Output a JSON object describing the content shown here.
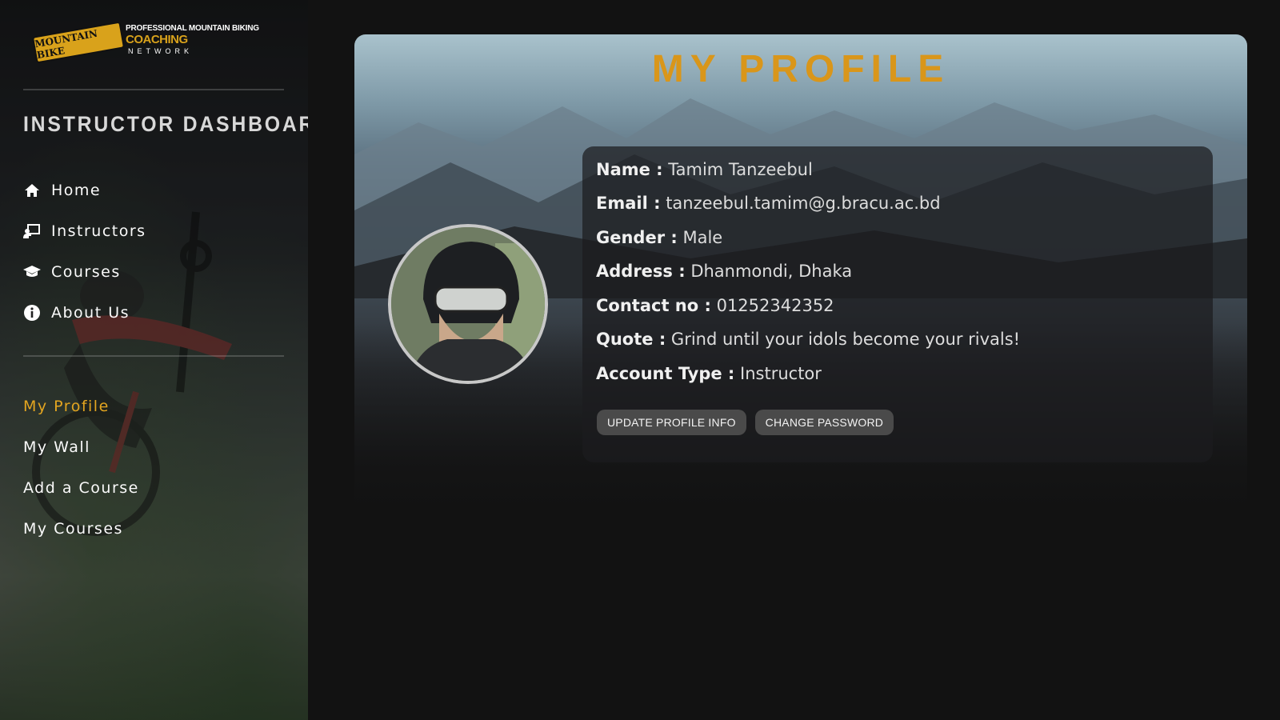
{
  "brand": {
    "badge_text": "MOUNTAIN BIKE",
    "line1": "PROFESSIONAL MOUNTAIN BIKING",
    "line2": "COACHING",
    "line3": "NETWORK"
  },
  "sidebar": {
    "title": "INSTRUCTOR DASHBOARD",
    "nav": [
      {
        "label": "Home",
        "icon": "home-icon"
      },
      {
        "label": "Instructors",
        "icon": "instructor-icon"
      },
      {
        "label": "Courses",
        "icon": "graduation-cap-icon"
      },
      {
        "label": "About Us",
        "icon": "info-icon"
      }
    ],
    "sub": [
      {
        "label": "My Profile",
        "active": true
      },
      {
        "label": "My Wall"
      },
      {
        "label": "Add a Course"
      },
      {
        "label": "My Courses"
      }
    ]
  },
  "main": {
    "title": "MY PROFILE",
    "profile": {
      "name_key": "Name :",
      "name": "Tamim Tanzeebul",
      "email_key": "Email :",
      "email": "tanzeebul.tamim@g.bracu.ac.bd",
      "gender_key": "Gender :",
      "gender": "Male",
      "address_key": "Address :",
      "address": "Dhanmondi, Dhaka",
      "contact_key": "Contact no :",
      "contact": "01252342352",
      "quote_key": "Quote :",
      "quote": "Grind until your idols become your rivals!",
      "account_key": "Account Type :",
      "account": "Instructor"
    },
    "buttons": {
      "update": "UPDATE PROFILE INFO",
      "change_password": "CHANGE PASSWORD"
    }
  },
  "colors": {
    "accent": "#d9961a",
    "active_nav": "#e3a520",
    "background": "#121212"
  }
}
